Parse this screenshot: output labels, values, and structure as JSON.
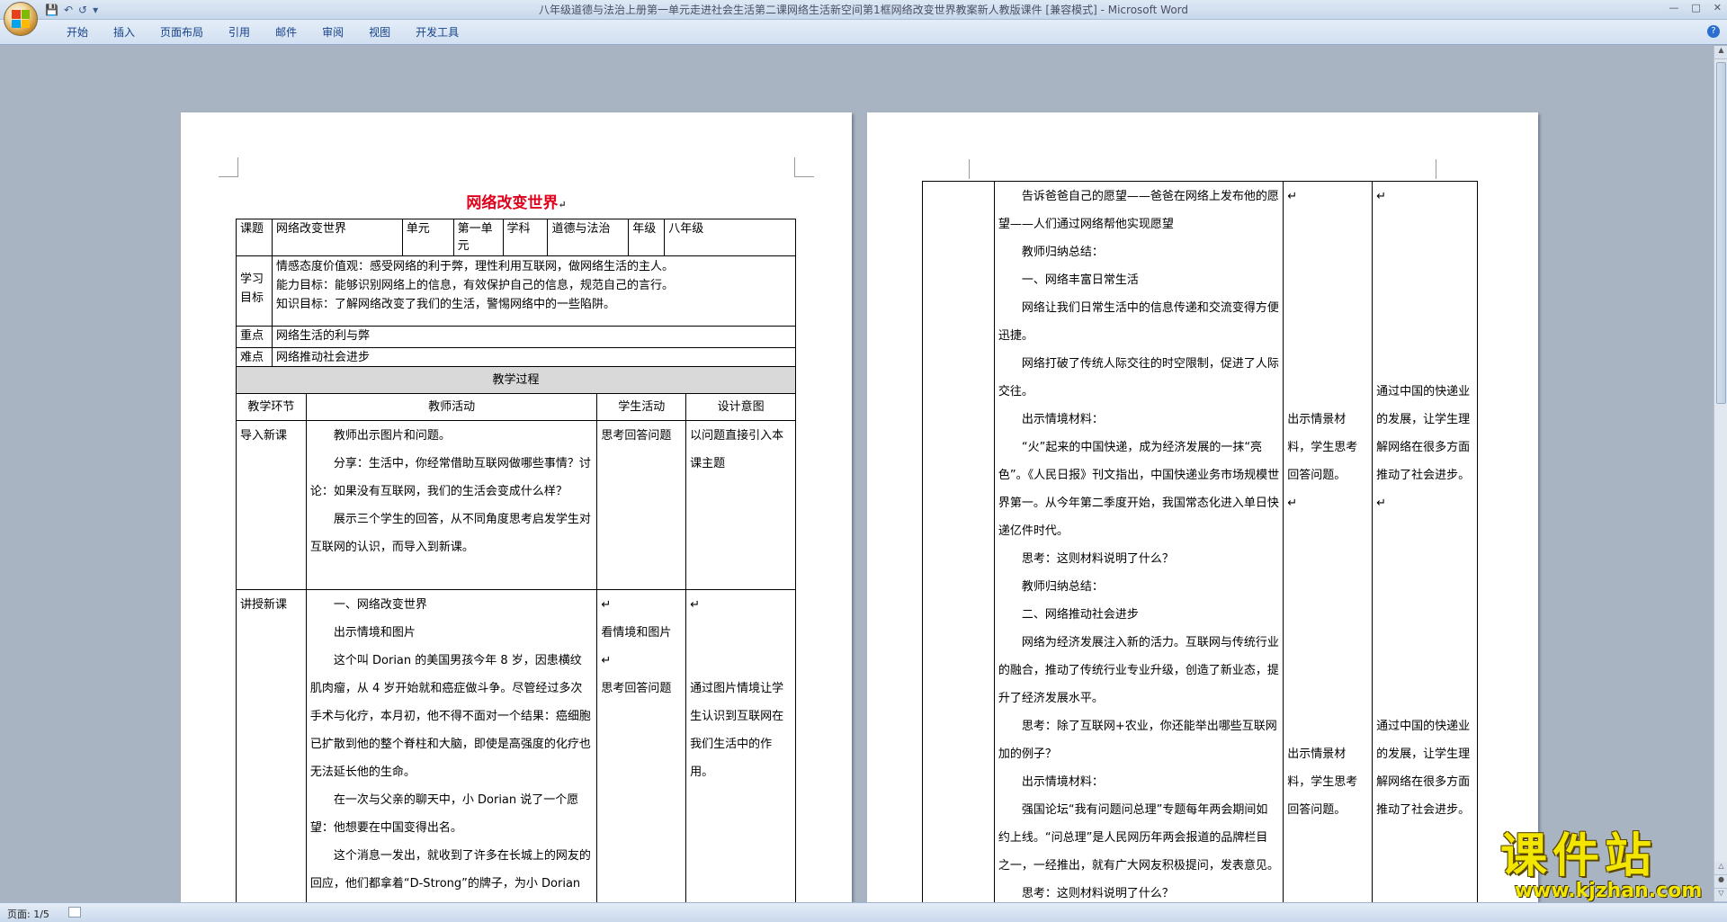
{
  "window": {
    "title": "八年级道德与法治上册第一单元走进社会生活第二课网络生活新空间第1框网络改变世界教案新人教版课件 [兼容模式] - Microsoft Word",
    "qat_icons": [
      "save-icon",
      "undo-icon",
      "redo-icon",
      "customize-icon"
    ]
  },
  "ribbon": {
    "tabs": [
      "开始",
      "插入",
      "页面布局",
      "引用",
      "邮件",
      "审阅",
      "视图",
      "开发工具"
    ]
  },
  "status": {
    "page": "页面: 1/5"
  },
  "watermark": {
    "line1": "课件站",
    "line2": "www.kjzhan.com"
  },
  "doc": {
    "title": "网络改变世界",
    "para_mark": "↵",
    "info": {
      "course_label": "课题",
      "course_value": "网络改变世界",
      "unit_label": "单元",
      "unit_value": "第一单元",
      "subject_label": "学科",
      "subject_value": "道德与法治",
      "grade_label": "年级",
      "grade_value": "八年级"
    },
    "goals": {
      "label": "学习目标",
      "items": [
        "情感态度价值观：感受网络的利于弊，理性利用互联网，做网络生活的主人。",
        "能力目标：能够识别网络上的信息，有效保护自己的信息，规范自己的言行。",
        "知识目标：了解网络改变了我们的生活，警惕网络中的一些陷阱。"
      ]
    },
    "focus": {
      "label": "重点",
      "value": "网络生活的利与弊"
    },
    "difficulty": {
      "label": "难点",
      "value": "网络推动社会进步"
    },
    "process_title": "教学过程",
    "headers": [
      "教学环节",
      "教师活动",
      "学生活动",
      "设计意图"
    ],
    "intro": {
      "stage": "导入新课",
      "teacher": [
        "教师出示图片和问题。",
        "分享：生活中，你经常借助互联网做哪些事情？讨论：如果没有互联网，我们的生活会变成什么样？",
        "展示三个学生的回答，从不同角度思考启发学生对互联网的认识，而导入到新课。"
      ],
      "student": "思考回答问题",
      "intent": "以问题直接引入本课主题"
    },
    "lecture": {
      "stage": "讲授新课",
      "teacher": [
        "一、网络改变世界",
        "出示情境和图片",
        "这个叫 Dorian 的美国男孩今年 8 岁，因患横纹肌肉瘤，从 4 岁开始就和癌症做斗争。尽管经过多次手术与化疗，本月初，他不得不面对一个结果：癌细胞已扩散到他的整个脊柱和大脑，即使是高强度的化疗也无法延长他的生命。",
        "在一次与父亲的聊天中，小 Dorian 说了一个愿望：他想要在中国变得出名。",
        "这个消息一发出，就收到了许多在长城上的网友的回应，他们都拿着“D-Strong”的牌子，为小 Dorian 拍照，并告诉他大家都在支持着他，要加油！不要放弃！"
      ],
      "student": [
        "看情境和图片",
        "思考回答问题"
      ],
      "intent": "通过图片情境让学生认识到互联网在我们生活中的作用。"
    },
    "page2": {
      "teacher": [
        "告诉爸爸自己的愿望——爸爸在网络上发布他的愿望——人们通过网络帮他实现愿望",
        "教师归纳总结：",
        "一、网络丰富日常生活",
        "网络让我们日常生活中的信息传递和交流变得方便迅捷。",
        "网络打破了传统人际交往的时空限制，促进了人际交往。",
        "出示情境材料：",
        "“火”起来的中国快递，成为经济发展的一抹“亮色”。《人民日报》刊文指出，中国快递业务市场规模世界第一。从今年第二季度开始，我国常态化进入单日快递亿件时代。",
        "思考：这则材料说明了什么？",
        "教师归纳总结：",
        "二、网络推动社会进步",
        "网络为经济发展注入新的活力。互联网与传统行业的融合，推动了传统行业专业升级，创造了新业态，提升了经济发展水平。",
        "思考：除了互联网+农业，你还能举出哪些互联网加的例子？",
        "出示情境材料：",
        "强国论坛“我有问题问总理”专题每年两会期间如约上线。“问总理”是人民网历年两会报道的品牌栏目之一，一经推出，就有广大网友积极提问，发表意见。",
        "思考：这则材料说明了什么？"
      ],
      "student_a": "出示情景材料，学生思考回答问题。",
      "student_b": "出示情景材料，学生思考回答问题。",
      "intent_a": "通过中国的快递业的发展，让学生理解网络在很多方面推动了社会进步。",
      "intent_b": "通过中国的快递业的发展，让学生理解网络在很多方面推动了社会进步。"
    }
  }
}
